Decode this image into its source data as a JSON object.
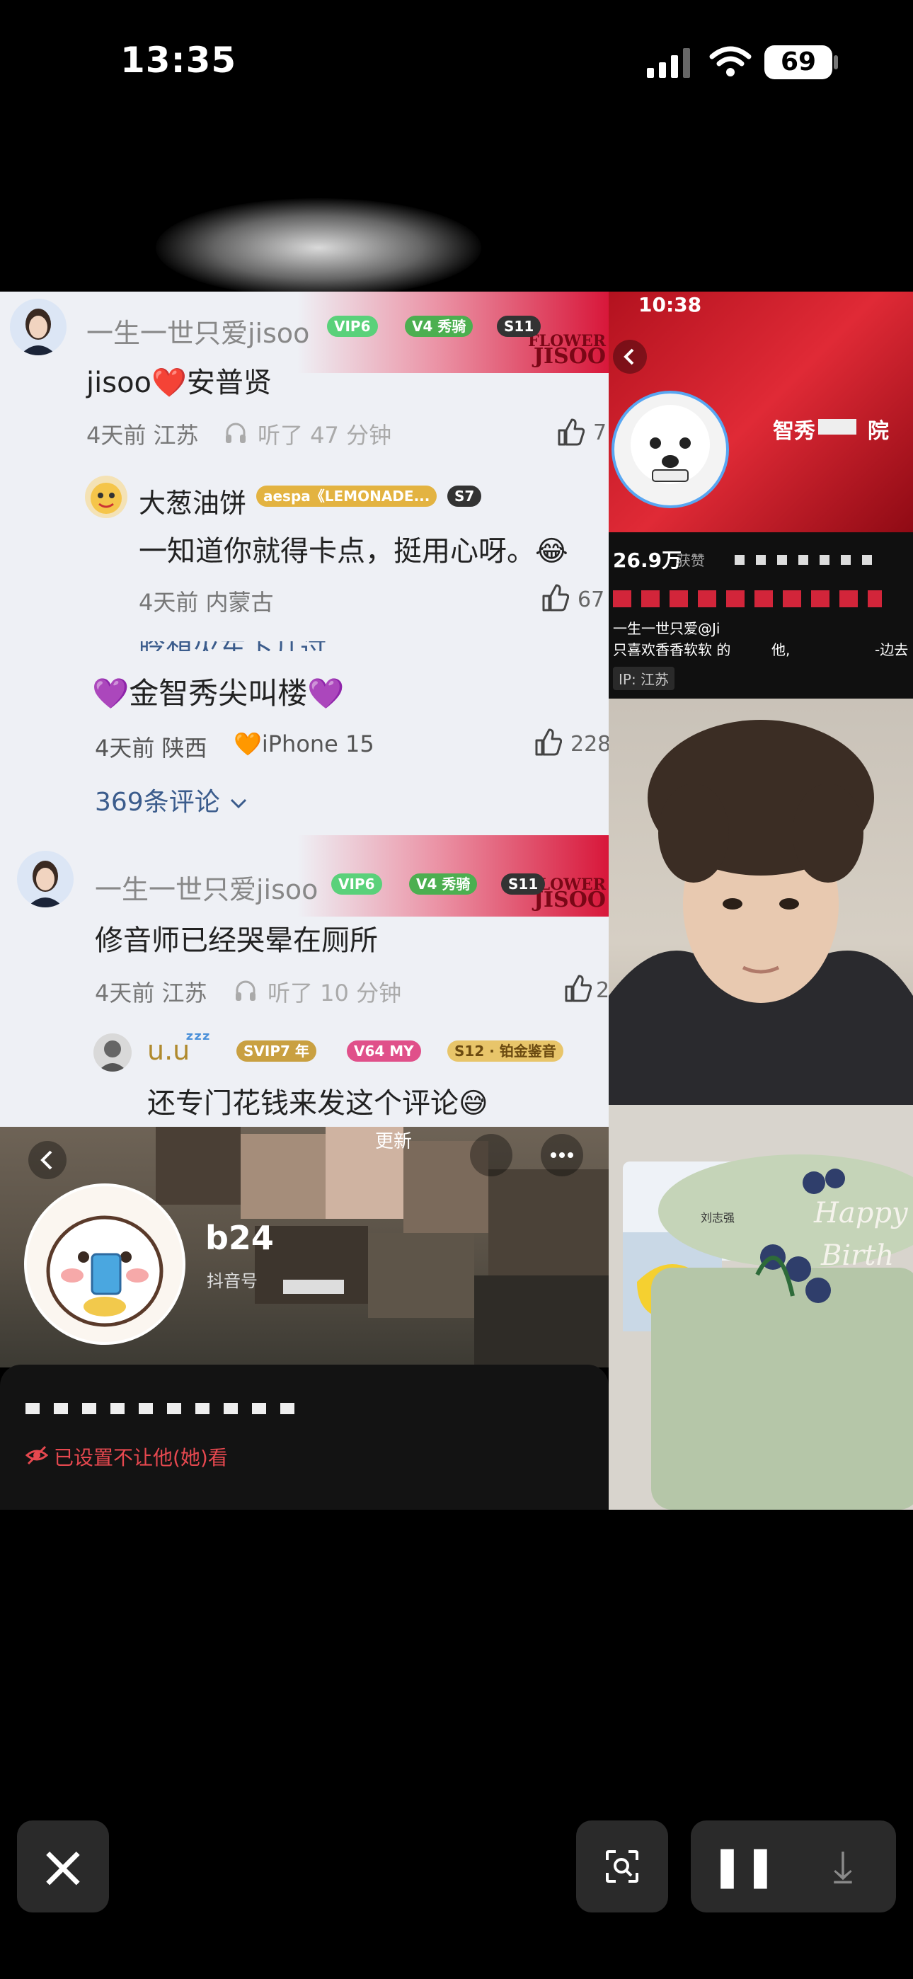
{
  "status_bar": {
    "time": "13:35",
    "battery": "69"
  },
  "comments": {
    "c1": {
      "user": "一生一世只爱jisoo",
      "badges": [
        "VIP6",
        "V4 秀骑",
        "S11"
      ],
      "text": "jisoo❤️安普贤",
      "meta": "4天前 江苏",
      "listen": "听了 47 分钟",
      "likes": "7"
    },
    "r1": {
      "user": "大葱油饼",
      "badges": [
        "aespa《LEMONADE...",
        "S7"
      ],
      "text": "一知道你就得卡点，挺用心呀。😂",
      "meta": "4天前 内蒙古",
      "likes": "67"
    },
    "partial_user": "晗想火车下几过",
    "c2": {
      "text": "💜金智秀尖叫楼💜",
      "meta": "4天前 陕西",
      "device": "🧡iPhone 15",
      "likes": "228",
      "expand": "369条评论"
    },
    "c3": {
      "user": "一生一世只爱jisoo",
      "badges": [
        "VIP6",
        "V4 秀骑",
        "S11"
      ],
      "text": "修音师已经哭晕在厕所",
      "meta": "4天前 江苏",
      "listen": "听了 10 分钟",
      "likes": "2"
    },
    "r3": {
      "user": "u.u",
      "badges": [
        "SVIP7 年",
        "V64 MY",
        "S12 · 铂金鉴音"
      ],
      "text": "还专门花钱来发这个评论😅"
    },
    "banner_word_1": "FLOWER",
    "banner_word_2": "JISOO"
  },
  "profile": {
    "name": "b24",
    "id_label": "抖音号",
    "top_label": "更新",
    "privacy": "已设置不让他(她)看"
  },
  "right_top": {
    "time": "10:38",
    "channel": "智秀",
    "channel_suffix": "院",
    "likes": "26.9万",
    "likes_label": "获赞",
    "line1": "一生一世只爱@Ji",
    "line2": "只喜欢香香软软 的",
    "line2b": "他,",
    "line2c": "-边去",
    "ip": "IP: 江苏"
  },
  "right_cake": {
    "card_name": "刘志强",
    "cake_text_1": "Happy",
    "cake_text_2": "Birth"
  },
  "controls": {
    "close": "×",
    "pause": "❚❚",
    "download": "⤓"
  },
  "colors": {
    "accent_red": "#d8173a",
    "vip_green": "#5ad17a",
    "heart": "#f07a7a",
    "link_blue": "#3b5c8c"
  }
}
